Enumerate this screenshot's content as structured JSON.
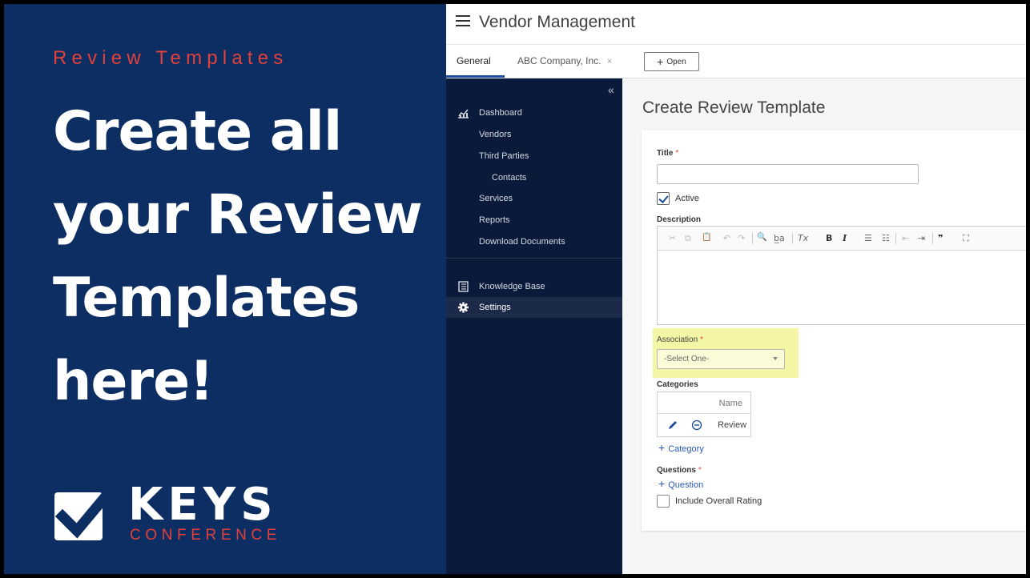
{
  "promo": {
    "eyebrow": "Review Templates",
    "headline": [
      "Create all",
      "your Review",
      "Templates",
      "here!"
    ],
    "logo_word": "KEYS",
    "logo_sub": "CONFERENCE"
  },
  "app": {
    "title": "Vendor Management",
    "tabs": [
      {
        "label": "General"
      },
      {
        "label": "ABC Company, Inc."
      }
    ],
    "tab_close": "×",
    "open_label": "Open",
    "plus": "+",
    "collapse": "«"
  },
  "sidebar": {
    "items": [
      {
        "label": "Dashboard",
        "icon": "dashboard-icon"
      },
      {
        "label": "Vendors"
      },
      {
        "label": "Third Parties"
      },
      {
        "label": "Contacts"
      },
      {
        "label": "Services"
      },
      {
        "label": "Reports"
      },
      {
        "label": "Download Documents"
      },
      {
        "label": "Knowledge Base",
        "icon": "book-icon"
      },
      {
        "label": "Settings",
        "icon": "gear-icon"
      }
    ]
  },
  "form": {
    "page_title": "Create Review Template",
    "title_label": "Title",
    "required_mark": "*",
    "title_value": "",
    "active_label": "Active",
    "active_checked": true,
    "description_label": "Description",
    "association_label": "Association",
    "association_value": "-Select One-",
    "categories_label": "Categories",
    "categories_header": "Name",
    "categories_rows": [
      "Review"
    ],
    "add_category": "Category",
    "questions_label": "Questions",
    "add_question": "Question",
    "overall_rating_label": "Include Overall Rating",
    "overall_rating_checked": false
  },
  "toolbar": {
    "cut": "✂",
    "copy": "⧉",
    "paste": "📋",
    "undo": "↶",
    "redo": "↷",
    "find": "🔍",
    "replace": "b̲a",
    "clear": "Tx",
    "bold": "B",
    "italic": "I",
    "ul": "☰",
    "ol": "☷",
    "outdent": "⇤",
    "indent": "⇥",
    "quote": "❞",
    "max": "⛶"
  },
  "colors": {
    "promo_bg": "#0d2e63",
    "accent_red": "#e2413b",
    "sidebar_bg": "#0a1a3a",
    "highlight": "#f4f6a6",
    "link_blue": "#2a5ab5"
  }
}
